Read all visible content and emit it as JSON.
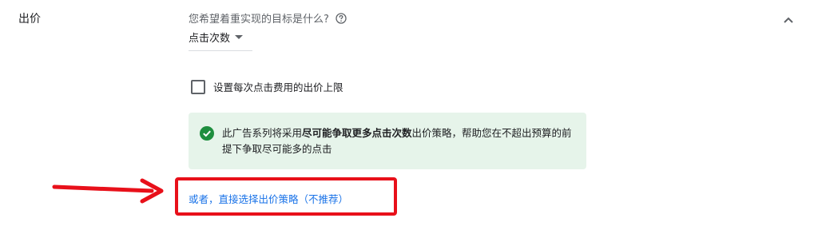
{
  "section": {
    "label": "出价"
  },
  "goal": {
    "question": "您希望着重实现的目标是什么?",
    "selected_value": "点击次数"
  },
  "max_cpc_checkbox": {
    "label": "设置每次点击费用的出价上限",
    "checked": false
  },
  "info_box": {
    "text_before": "此广告系列将采用",
    "text_bold": "尽可能争取更多点击次数",
    "text_after": "出价策略，帮助您在不超出预算的前提下争取尽可能多的点击"
  },
  "alt_link": {
    "label": "或者，直接选择出价策略（不推荐）"
  },
  "icons": {
    "help": "help-circle-icon",
    "collapse": "chevron-up-icon",
    "dropdown": "caret-down-icon",
    "success": "check-circle-icon",
    "annotation": "red-arrow-icon"
  },
  "colors": {
    "link": "#1a73e8",
    "info_bg": "#e6f4ea",
    "success": "#1e8e3e",
    "annotation": "#e8101a"
  }
}
